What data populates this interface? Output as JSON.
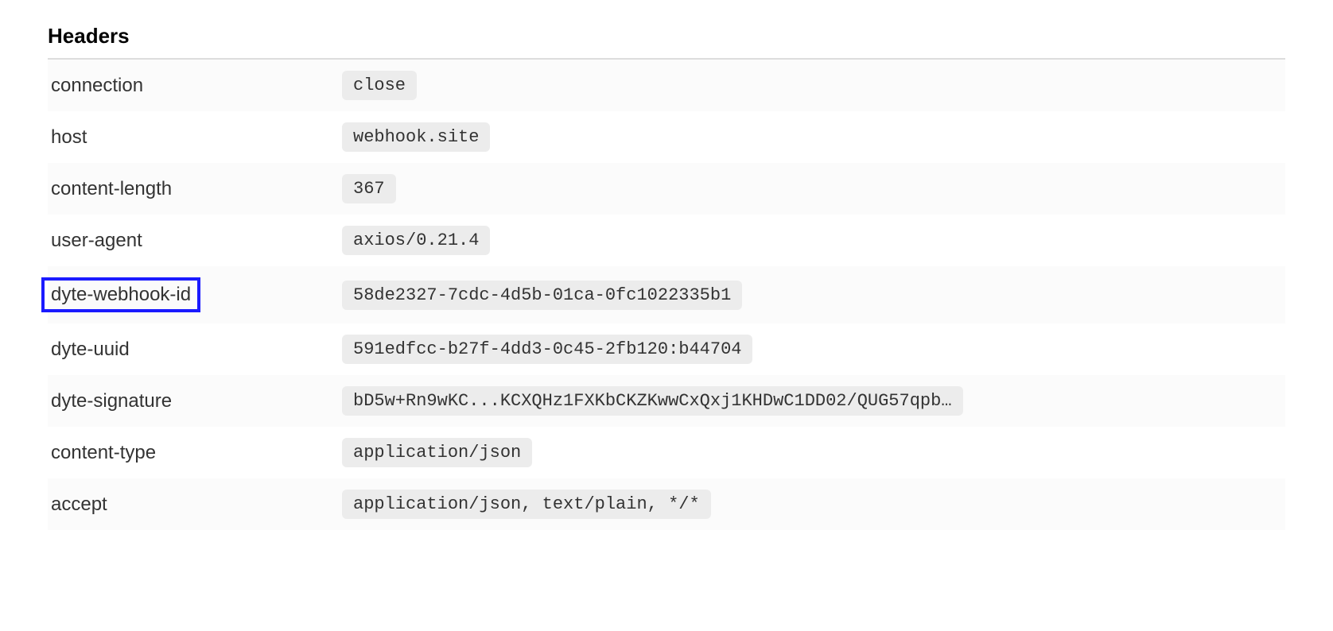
{
  "section_title": "Headers",
  "headers": [
    {
      "key": "connection",
      "value": "close",
      "highlighted": false
    },
    {
      "key": "host",
      "value": "webhook.site",
      "highlighted": false
    },
    {
      "key": "content-length",
      "value": "367",
      "highlighted": false
    },
    {
      "key": "user-agent",
      "value": "axios/0.21.4",
      "highlighted": false
    },
    {
      "key": "dyte-webhook-id",
      "value": "58de2327-7cdc-4d5b-01ca-0fc1022335b1",
      "highlighted": true
    },
    {
      "key": "dyte-uuid",
      "value": "591edfcc-b27f-4dd3-0c45-2fb120:b44704",
      "highlighted": false
    },
    {
      "key": "dyte-signature",
      "value": "bD5w+Rn9wKC...KCXQHz1FXKbCKZKwwCxQxj1KHDwC1DD02/QUG57qpb…",
      "highlighted": false
    },
    {
      "key": "content-type",
      "value": "application/json",
      "highlighted": false
    },
    {
      "key": "accept",
      "value": "application/json, text/plain, */*",
      "highlighted": false
    }
  ]
}
